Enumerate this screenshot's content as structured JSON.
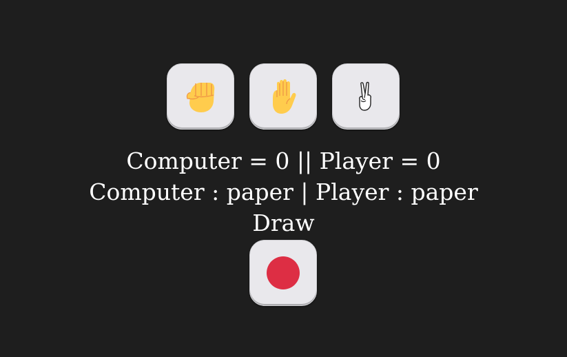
{
  "choices": [
    {
      "name": "rock",
      "icon": "raised-fist-icon"
    },
    {
      "name": "paper",
      "icon": "raised-hand-icon"
    },
    {
      "name": "scissors",
      "icon": "victory-hand-icon"
    }
  ],
  "score": {
    "computer_label": "Computer",
    "computer_value": "0",
    "player_label": "Player",
    "player_value": "0",
    "separator": "||",
    "line": "Computer = 0 || Player = 0"
  },
  "moves": {
    "line": "Computer : paper | Player : paper",
    "computer_move": "paper",
    "player_move": "paper"
  },
  "result": {
    "text": "Draw"
  },
  "reset": {
    "icon": "red-circle-icon",
    "color": "#dd2e44"
  },
  "colors": {
    "background": "#1e1e1e",
    "button": "#e9e8ec",
    "text": "#ffffff",
    "emoji_yellow": "#ffcc4d",
    "emoji_shade": "#ef9645"
  }
}
